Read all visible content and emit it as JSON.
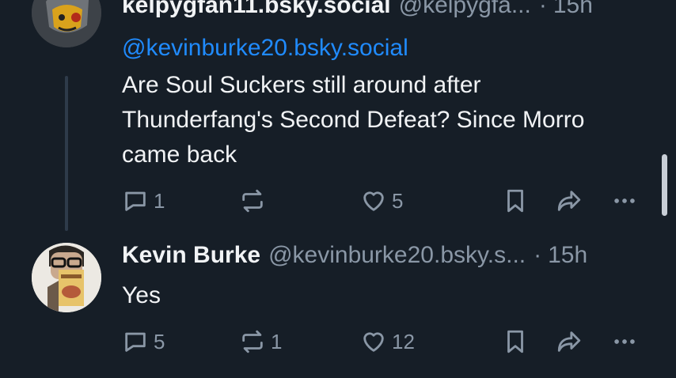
{
  "post1": {
    "name": "kelpygfan11.bsky.social",
    "handle": "@kelpygfa...",
    "separator": "·",
    "time": "15h",
    "mention": "@kevinburke20.bsky.social",
    "text": "Are Soul Suckers still around after Thunderfang's Second Defeat? Since Morro came back",
    "replies": "1",
    "reposts": "",
    "likes": "5"
  },
  "post2": {
    "name": "Kevin Burke",
    "handle": "@kevinburke20.bsky.s...",
    "separator": "·",
    "time": "15h",
    "text": "Yes",
    "replies": "5",
    "reposts": "1",
    "likes": "12"
  },
  "colors": {
    "background": "#161e27",
    "mention": "#208bfe",
    "muted": "#8a97a6"
  }
}
